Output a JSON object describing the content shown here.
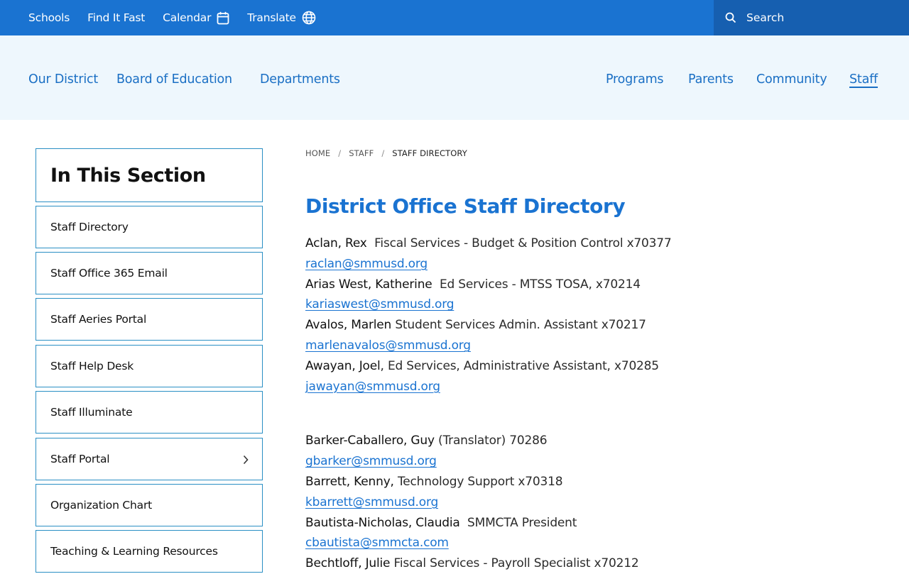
{
  "utility_bar": {
    "schools": "Schools",
    "find_it_fast": "Find It Fast",
    "calendar": "Calendar",
    "translate": "Translate",
    "search_placeholder": "Search"
  },
  "main_nav": {
    "our_district": "Our District",
    "board": "Board of Education",
    "departments": "Departments",
    "programs": "Programs",
    "parents": "Parents",
    "community": "Community",
    "staff": "Staff"
  },
  "sidebar": {
    "heading": "In This Section",
    "items": [
      {
        "label": "Staff Directory"
      },
      {
        "label": "Staff Office 365 Email"
      },
      {
        "label": "Staff Aeries Portal"
      },
      {
        "label": "Staff Help Desk"
      },
      {
        "label": "Staff Illuminate"
      },
      {
        "label": "Staff Portal"
      },
      {
        "label": "Organization Chart"
      },
      {
        "label": "Teaching & Learning Resources"
      }
    ]
  },
  "breadcrumb": {
    "home": "HOME",
    "staff": "STAFF",
    "current": "STAFF DIRECTORY"
  },
  "page_title": "District Office Staff Directory",
  "group1": [
    {
      "name": "Aclan, Rex",
      "detail": "  Fiscal Services - Budget & Position Control x70377",
      "email": "raclan@smmusd.org"
    },
    {
      "name": "Arias West, Katherine",
      "detail": "  Ed Services - MTSS TOSA, x70214",
      "email": "kariaswest@smmusd.org"
    },
    {
      "name": "Avalos, Marlen",
      "detail": " Student Services Admin. Assistant x70217",
      "email": "marlenavalos@smmusd.org"
    },
    {
      "name": "Awayan, Joel",
      "detail": ", Ed Services, Administrative Assistant, x70285",
      "email": "jawayan@smmusd.org"
    }
  ],
  "group2": [
    {
      "name": "Barker-Caballero, Guy",
      "detail": " (Translator) 70286",
      "email": "gbarker@smmusd.org"
    },
    {
      "name": "Barrett, Kenny,",
      "detail": " Technology Support x70318",
      "email": "kbarrett@smmusd.org"
    },
    {
      "name": "Bautista-Nicholas, Claudia",
      "detail": "  SMMCTA President",
      "email": "cbautista@smmcta.com"
    },
    {
      "name": "Bechtloff, Julie",
      "detail": " Fiscal Services - Payroll Specialist x70212"
    }
  ]
}
